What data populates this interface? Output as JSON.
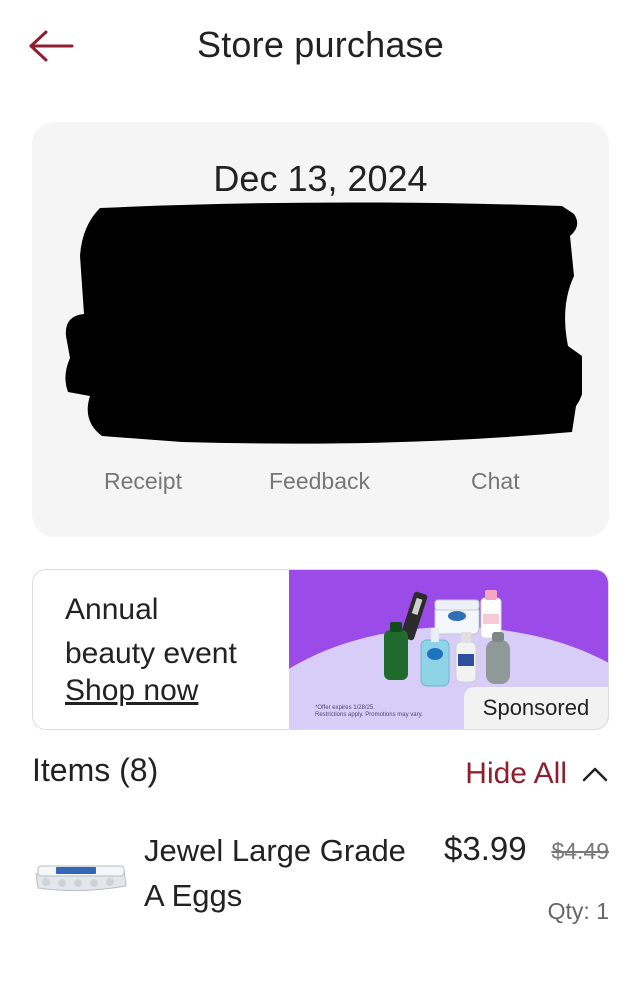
{
  "colors": {
    "accent": "#8f1f2f",
    "card_bg": "#f5f5f5",
    "ad_purple": "#9b4be8"
  },
  "header": {
    "title": "Store purchase",
    "back_icon": "arrow-left-icon"
  },
  "purchase": {
    "date": "Dec 13, 2024",
    "actions": {
      "receipt": "Receipt",
      "feedback": "Feedback",
      "chat": "Chat"
    }
  },
  "ad": {
    "line1": "Annual",
    "line2": "beauty event",
    "cta": "Shop now",
    "disclaimer_1": "*Offer expires 1/28/25.",
    "disclaimer_2": "Restrictions apply. Promotions may vary.",
    "sponsored": "Sponsored"
  },
  "items": {
    "title": "Items (8)",
    "hide_all": "Hide All",
    "list": [
      {
        "name_line1": "Jewel Large Grade",
        "name_line2": "A Eggs",
        "price": "$3.99",
        "original_price": "$4.49",
        "qty": "Qty: 1"
      }
    ]
  }
}
